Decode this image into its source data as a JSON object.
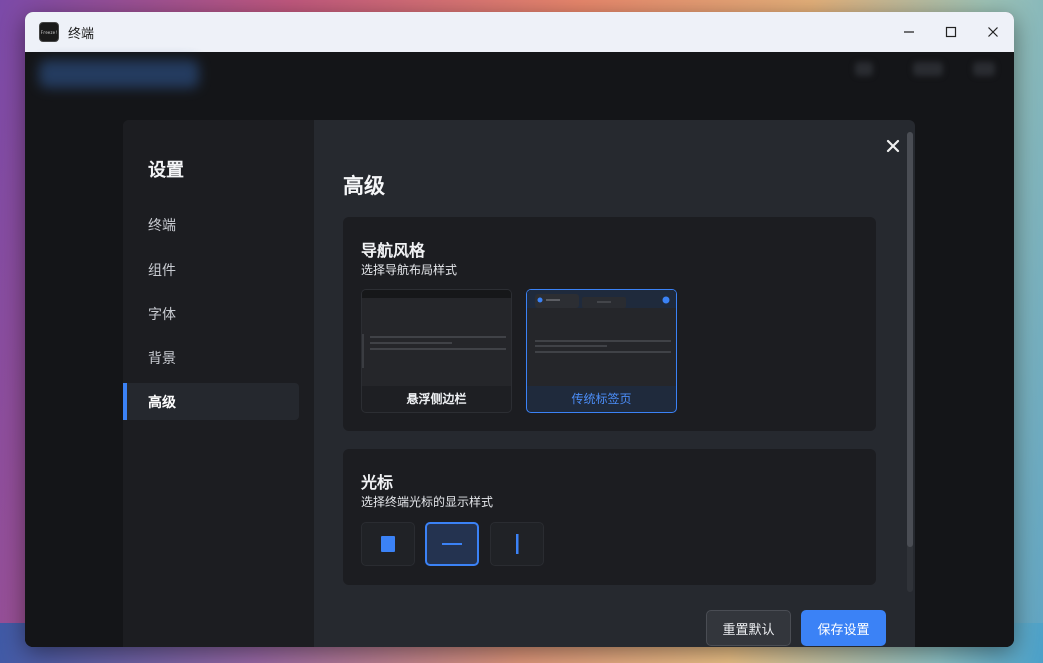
{
  "window": {
    "title": "终端",
    "app_icon_text": "Freeze!"
  },
  "settings": {
    "sidebar_title": "设置",
    "nav_items": [
      {
        "label": "终端",
        "active": false
      },
      {
        "label": "组件",
        "active": false
      },
      {
        "label": "字体",
        "active": false
      },
      {
        "label": "背景",
        "active": false
      },
      {
        "label": "高级",
        "active": true
      }
    ],
    "page_title": "高级",
    "navigation_style": {
      "title": "导航风格",
      "description": "选择导航布局样式",
      "options": [
        {
          "label": "悬浮侧边栏",
          "selected": false
        },
        {
          "label": "传统标签页",
          "selected": true
        }
      ]
    },
    "cursor": {
      "title": "光标",
      "description": "选择终端光标的显示样式",
      "options": [
        {
          "icon": "block-cursor-icon",
          "selected": false
        },
        {
          "icon": "underline-cursor-icon",
          "selected": true
        },
        {
          "icon": "bar-cursor-icon",
          "selected": false
        }
      ]
    },
    "buttons": {
      "reset": "重置默认",
      "save": "保存设置"
    }
  },
  "colors": {
    "accent": "#3b82f6",
    "dialog_bg": "#26292f",
    "card_bg": "#1c1d21"
  }
}
